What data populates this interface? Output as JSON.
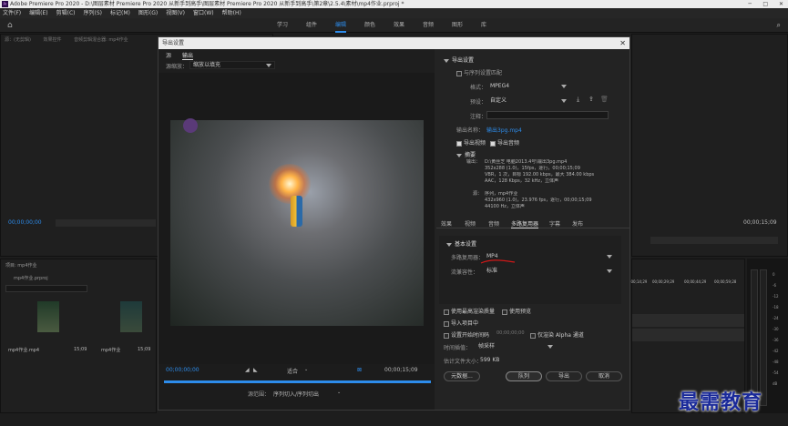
{
  "app": {
    "title": "Adobe Premiere Pro 2020 - D:\\图层素材 Premiere Pro 2020 从新手到高手\\图层素材 Premiere Pro 2020 从新手到高手\\第2章\\2.5.4\\素材\\mp4作业.prproj *"
  },
  "menu": [
    "文件(F)",
    "编辑(E)",
    "剪辑(C)",
    "序列(S)",
    "标记(M)",
    "图形(G)",
    "视图(V)",
    "窗口(W)",
    "帮助(H)"
  ],
  "workspaces": [
    "学习",
    "组件",
    "编辑",
    "颜色",
    "效果",
    "音频",
    "图形",
    "库"
  ],
  "active_workspace": "编辑",
  "left_panel": {
    "tab1": "源：(无剪辑)",
    "tab2": "效果控件",
    "tab3": "音频剪辑混合器: mp4作业",
    "timecode": "00;00;00;00"
  },
  "project_panel": {
    "title": "项目: mp4作业",
    "file": "mp4作业.prproj",
    "items": [
      {
        "name": "mp4作业.mp4",
        "duration": "15;09"
      },
      {
        "name": "mp4作业",
        "duration": "15;09"
      }
    ]
  },
  "program_panel": {
    "timecode": "00;00;15;09"
  },
  "timeline": {
    "ruler": [
      "00;00;14;29",
      "00;00;29;29",
      "00;00;44;29",
      "00;00;59;28"
    ]
  },
  "meter_scale": [
    "0",
    "-6",
    "-12",
    "-18",
    "-24",
    "-30",
    "-36",
    "-42",
    "-48",
    "-54",
    "dB"
  ],
  "dialog": {
    "title": "导出设置",
    "tabs": [
      "源",
      "输出"
    ],
    "active_tab": "输出",
    "source_scaling_label": "源缩放：",
    "source_scaling_value": "缩放以填充",
    "export_settings": {
      "section": "导出设置",
      "match_sequence": "与序列设置匹配",
      "format_label": "格式：",
      "format_value": "MPEG4",
      "preset_label": "预设：",
      "preset_value": "自定义",
      "comments_label": "注释：",
      "output_name_label": "输出名称：",
      "output_name_value": "输出3pg.mp4",
      "export_video": "导出视频",
      "export_audio": "导出音频"
    },
    "summary": {
      "section": "摘要",
      "output_label": "输出：",
      "output_lines": [
        "D:\\黄丝芝 电脑2013.4号\\输出3pg.mp4",
        "352x288 (1.0)，15fps，逐行，00;00;15;09",
        "VBR，1 次，目标 192.00 kbps，最大 384.00 kbps",
        "AAC，128 Kbps，32 kHz，立体声"
      ],
      "source_label": "源：",
      "source_lines": [
        "序列，mp4作业",
        "432x960 (1.0)，23.976 fps，逐行，00;00;15;09",
        "44100 Hz，立体声"
      ]
    },
    "settings_tabs": [
      "效果",
      "视频",
      "音频",
      "多路复用器",
      "字幕",
      "发布"
    ],
    "active_settings_tab": "多路复用器",
    "basic": {
      "section": "基本设置",
      "multiplexer_label": "多路复用器：",
      "multiplexer_value": "MP4",
      "compat_label": "流兼容性：",
      "compat_value": "标准"
    },
    "options": {
      "max_render": "使用最高渲染质量",
      "use_preview": "使用预览",
      "import_project": "导入项目中",
      "set_timecode": "设置开始时间码",
      "timecode_value": "00;00;00;00",
      "alpha_only": "仅渲染 Alpha 通道",
      "interpolation_label": "时间插值：",
      "interpolation_value": "帧采样",
      "filesize_label": "估计文件大小：",
      "filesize_value": "599 KB"
    },
    "buttons": {
      "metadata": "元数据...",
      "queue": "队列",
      "export": "导出",
      "cancel": "取消"
    },
    "preview": {
      "timecode_in": "00;00;00;00",
      "timecode_out": "00;00;15;09",
      "fit": "适合",
      "range_label": "源范围：",
      "range_value": "序列切入/序列切出"
    }
  },
  "watermark": "最需教育",
  "colors": {
    "accent": "#2d8ceb",
    "annotation": "#d01818"
  }
}
